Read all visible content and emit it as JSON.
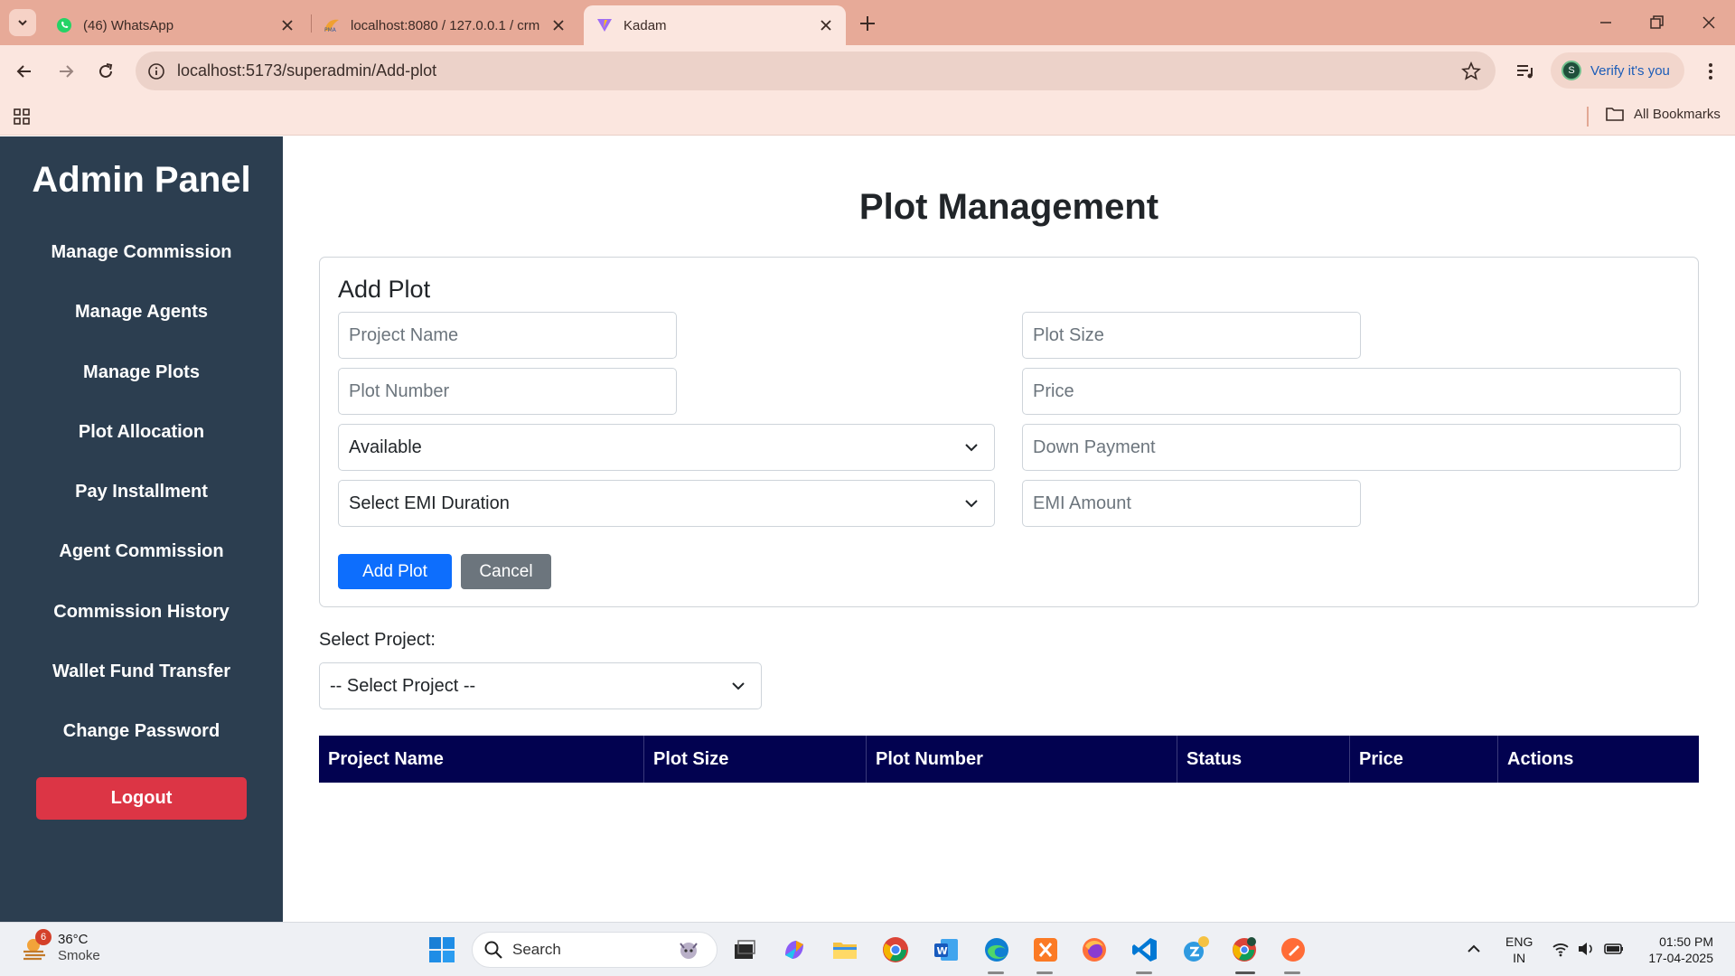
{
  "browser": {
    "tabs": [
      {
        "title": "(46) WhatsApp"
      },
      {
        "title": "localhost:8080 / 127.0.0.1 / crm"
      },
      {
        "title": "Kadam"
      }
    ],
    "url": "localhost:5173/superadmin/Add-plot",
    "verify_label": "Verify it's you",
    "profile_initial": "S",
    "all_bookmarks": "All Bookmarks"
  },
  "sidebar": {
    "brand": "Admin Panel",
    "items": [
      {
        "label": "Manage Commission"
      },
      {
        "label": "Manage Agents"
      },
      {
        "label": "Manage Plots"
      },
      {
        "label": "Plot Allocation"
      },
      {
        "label": "Pay Installment"
      },
      {
        "label": "Agent Commission"
      },
      {
        "label": "Commission History"
      },
      {
        "label": "Wallet Fund Transfer"
      },
      {
        "label": "Change Password"
      }
    ],
    "logout": "Logout"
  },
  "main": {
    "title": "Plot Management",
    "form": {
      "title": "Add Plot",
      "project_name_placeholder": "Project Name",
      "plot_size_placeholder": "Plot Size",
      "plot_number_placeholder": "Plot Number",
      "price_placeholder": "Price",
      "status_value": "Available",
      "down_payment_placeholder": "Down Payment",
      "emi_duration_value": "Select EMI Duration",
      "emi_amount_placeholder": "EMI Amount",
      "add_button": "Add Plot",
      "cancel_button": "Cancel"
    },
    "select_project_label": "Select Project:",
    "select_project_value": "-- Select Project --",
    "table": {
      "columns": [
        "Project Name",
        "Plot Size",
        "Plot Number",
        "Status",
        "Price",
        "Actions"
      ]
    }
  },
  "taskbar": {
    "weather_temp": "36°C",
    "weather_desc": "Smoke",
    "weather_badge": "6",
    "search_label": "Search",
    "lang_line1": "ENG",
    "lang_line2": "IN",
    "time": "01:50 PM",
    "date": "17-04-2025"
  }
}
